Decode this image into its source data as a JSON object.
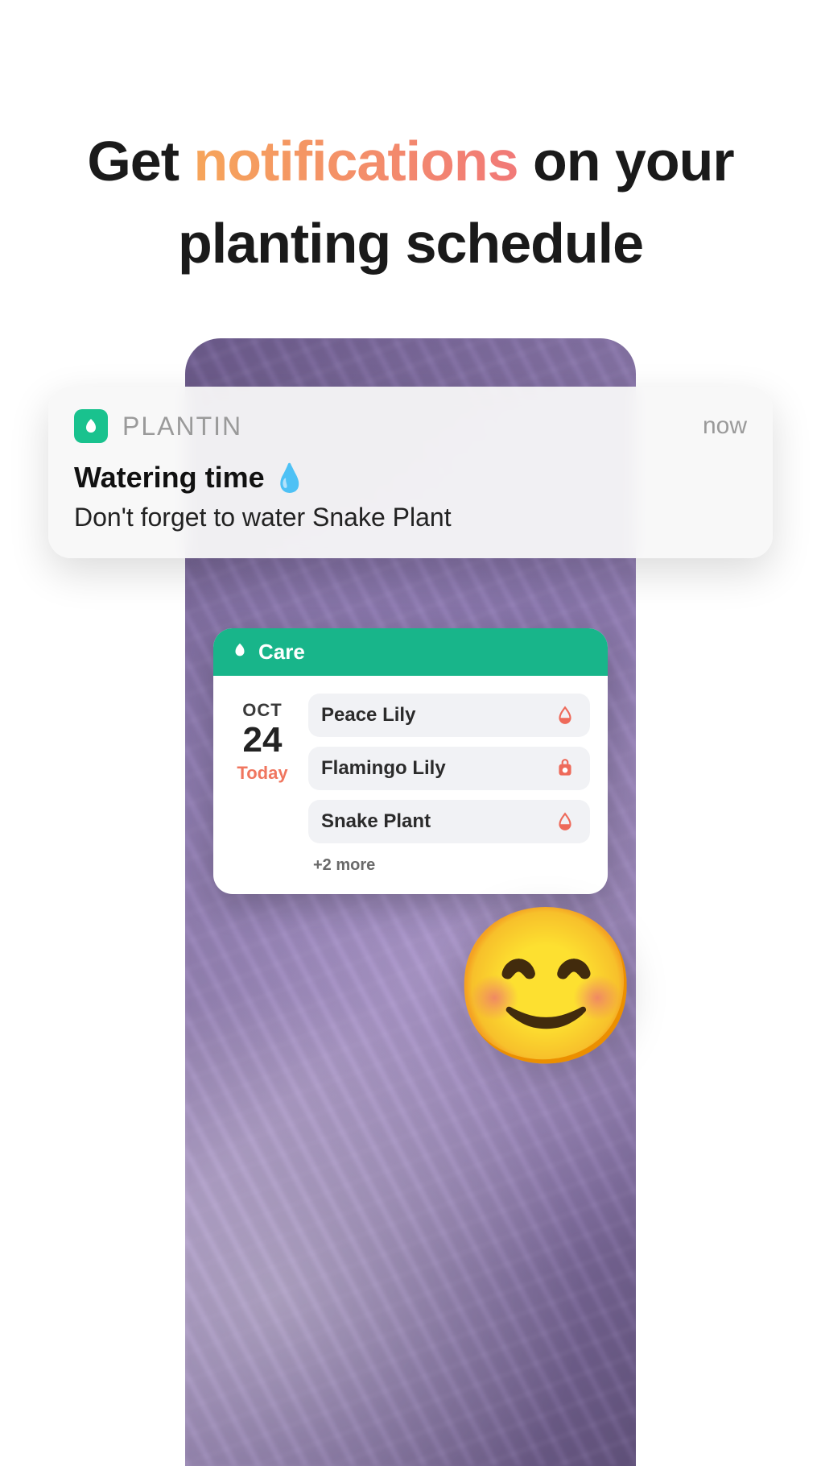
{
  "headline": {
    "pre": "Get ",
    "accent": "notifications",
    "post": " on your planting schedule"
  },
  "notification": {
    "app_name": "PLANTIN",
    "time": "now",
    "title": "Watering time ",
    "title_emoji": "💧",
    "body": "Don't forget to water Snake Plant"
  },
  "care_widget": {
    "header": "Care",
    "month": "OCT",
    "day": "24",
    "today_label": "Today",
    "items": [
      {
        "name": "Peace Lily",
        "icon": "water-icon"
      },
      {
        "name": "Flamingo Lily",
        "icon": "feed-icon"
      },
      {
        "name": "Snake Plant",
        "icon": "water-icon"
      }
    ],
    "more": "+2 more"
  },
  "emoji": "😊"
}
